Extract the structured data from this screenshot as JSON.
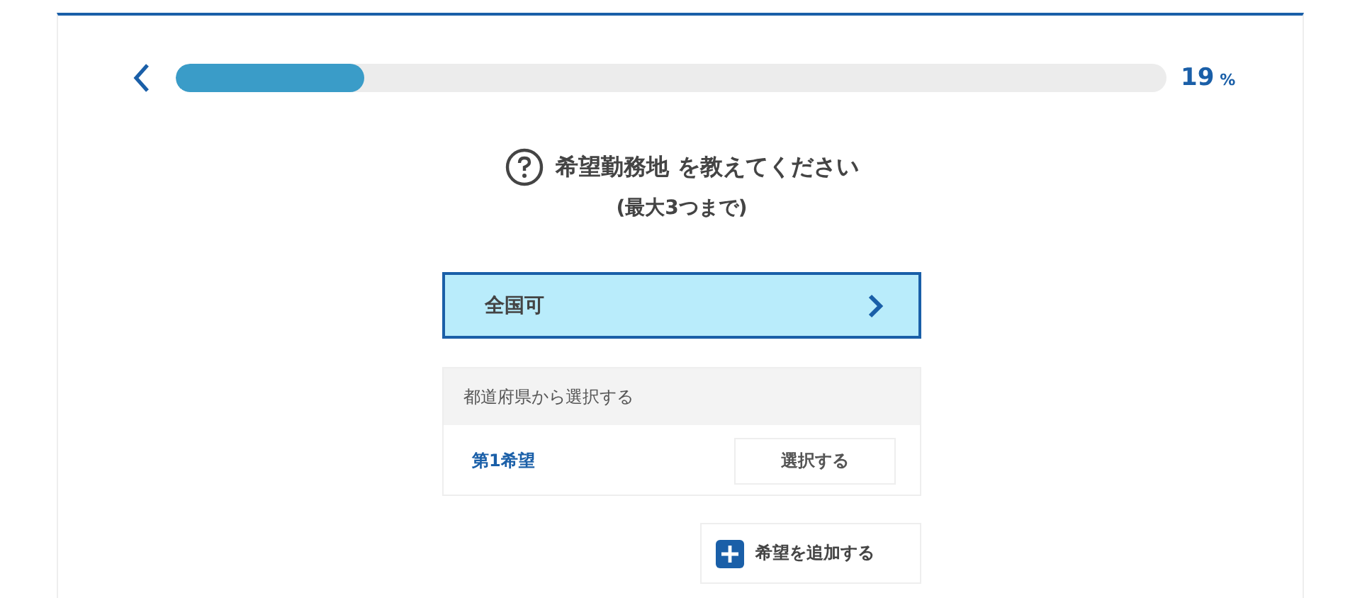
{
  "progress": {
    "level": 0.19,
    "value": "19",
    "unit": "%"
  },
  "question": {
    "title": "**希望勤務地** を教えてください",
    "note": "(最大3つまで)"
  },
  "nationwide": {
    "label": "全国可",
    "selected": true
  },
  "prefecture_panel": {
    "header": "都道府県から選択する",
    "rows": [
      {
        "label": "第1希望",
        "button": "選択する"
      }
    ]
  },
  "add_button": "希望を追加する"
}
